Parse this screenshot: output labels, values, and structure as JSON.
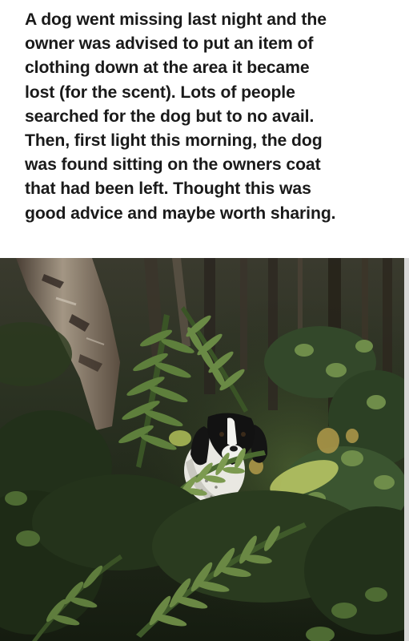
{
  "post": {
    "caption_lines": [
      "A dog went missing last night and the",
      "owner was advised to put an item of",
      "clothing down at the area it became",
      "lost (for the scent). Lots of people",
      "searched for the dog but to no avail.",
      "Then, first light this morning, the dog",
      "was found sitting on the owners coat",
      "that had been left. Thought this was",
      "good advice and maybe worth sharing."
    ]
  },
  "colors": {
    "caption_text": "#1a1a1a",
    "page_background": "#ffffff",
    "foliage_dark": "#1b2414",
    "foliage_mid": "#3f5a2c",
    "foliage_light": "#7e9a55",
    "bark": "#8a7b6a",
    "dog_white": "#f0f0ec",
    "dog_black": "#121212"
  },
  "photo": {
    "subject": "dog-in-woodland"
  }
}
